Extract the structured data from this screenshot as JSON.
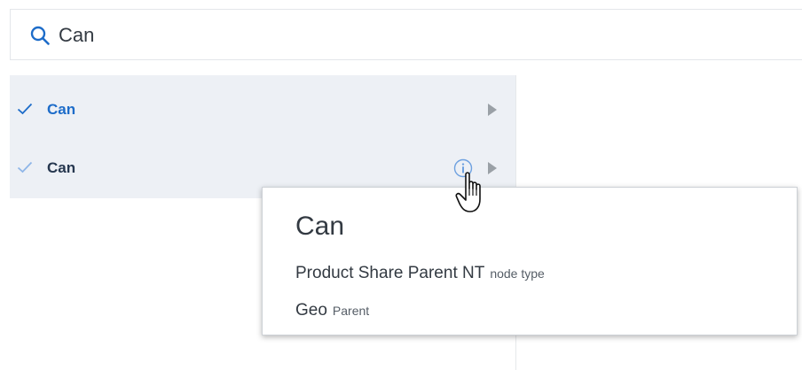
{
  "search": {
    "value": "Can",
    "icon": "search-icon"
  },
  "results": [
    {
      "label": "Can",
      "selected": true,
      "check_color": "#1d6cc9",
      "label_color": "#1d6cc9"
    },
    {
      "label": "Can",
      "selected": true,
      "check_color": "#8fb6e8",
      "label_color": "#26374f"
    }
  ],
  "tooltip": {
    "title": "Can",
    "lines": [
      {
        "value": "Product Share Parent NT",
        "meta": "node type"
      },
      {
        "value": "Geo",
        "meta": "Parent"
      }
    ]
  },
  "colors": {
    "accent": "#1d6cc9",
    "list_background": "#edf0f5",
    "arrow": "#9aa0a6"
  }
}
